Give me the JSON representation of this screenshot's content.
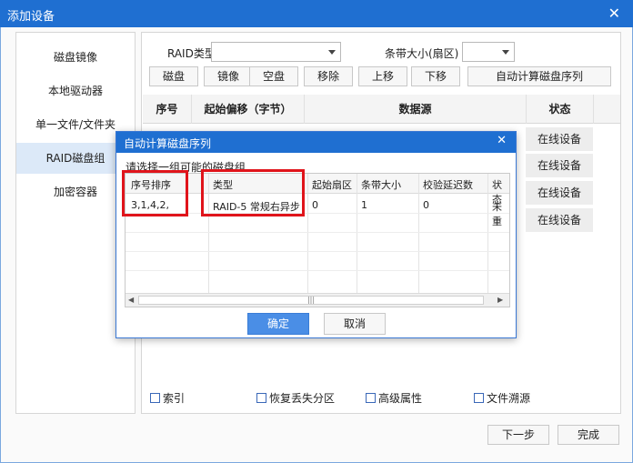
{
  "window": {
    "title": "添加设备"
  },
  "sidebar": {
    "items": [
      {
        "label": "磁盘镜像"
      },
      {
        "label": "本地驱动器"
      },
      {
        "label": "单一文件/文件夹"
      },
      {
        "label": "RAID磁盘组"
      },
      {
        "label": "加密容器"
      }
    ]
  },
  "toolbar": {
    "raid_type_label": "RAID类型",
    "raid_type_value": "",
    "stripe_label": "条带大小(扇区)",
    "stripe_value": "",
    "buttons": [
      {
        "label": "磁盘"
      },
      {
        "label": "镜像"
      },
      {
        "label": "空盘"
      },
      {
        "label": "移除"
      },
      {
        "label": "上移"
      },
      {
        "label": "下移"
      },
      {
        "label": "自动计算磁盘序列"
      }
    ]
  },
  "grid": {
    "headers": [
      "序号",
      "起始偏移（字节）",
      "数据源",
      "状态"
    ],
    "status_values": [
      "在线设备",
      "在线设备",
      "在线设备",
      "在线设备"
    ]
  },
  "options": [
    {
      "label": "索引",
      "checked": false
    },
    {
      "label": "恢复丢失分区",
      "checked": false
    },
    {
      "label": "高级属性",
      "checked": false
    },
    {
      "label": "文件溯源",
      "checked": false
    }
  ],
  "footer": {
    "next_label": "下一步",
    "finish_label": "完成"
  },
  "dialog": {
    "title": "自动计算磁盘序列",
    "hint": "请选择一组可能的磁盘组",
    "headers": [
      "序号排序",
      "类型",
      "起始扇区",
      "条带大小",
      "校验延迟数",
      "状态"
    ],
    "row": [
      "3,1,4,2,",
      "RAID-5 常规右异步",
      "0",
      "1",
      "0",
      "未重"
    ],
    "ok_label": "确定",
    "cancel_label": "取消"
  },
  "colors": {
    "title_bar": "#1f6fd1",
    "selected": "#dce9f8",
    "ok_button": "#4a8ee6",
    "highlight": "#e0141b"
  },
  "icons": {
    "close": "close-icon",
    "dropdown": "chevron-down-icon",
    "scroll_left": "arrow-left-icon",
    "scroll_right": "arrow-right-icon"
  }
}
